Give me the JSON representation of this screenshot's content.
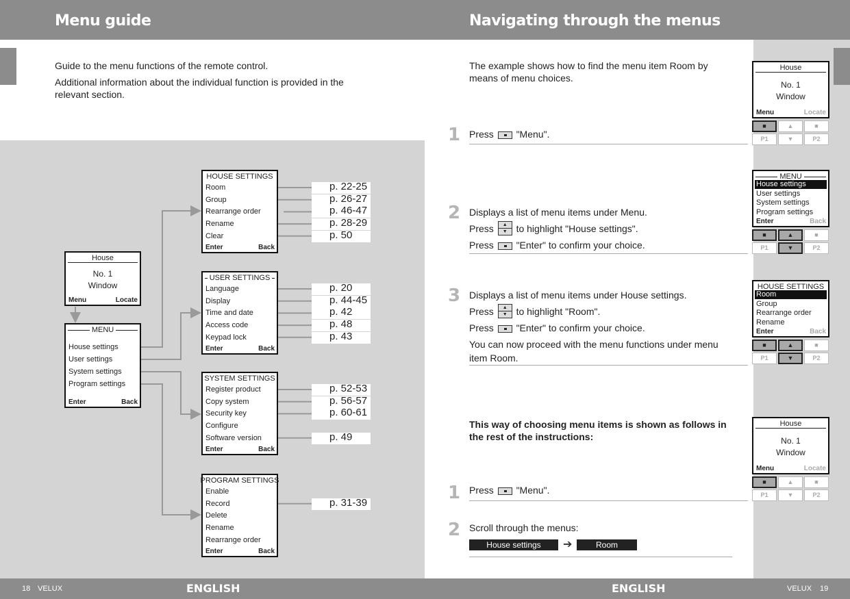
{
  "header": {
    "left_title": "Menu guide",
    "right_title": "Navigating through the menus"
  },
  "left": {
    "intro": [
      "Guide to the menu functions of the remote control.",
      "Additional information about the individual function is provided in the relevant section."
    ]
  },
  "diagram": {
    "home": {
      "title": "House",
      "line1": "No. 1",
      "line2": "Window",
      "left_key": "Menu",
      "right_key": "Locate"
    },
    "menu": {
      "title": "MENU",
      "items": [
        "House settings",
        "User settings",
        "System settings",
        "Program settings"
      ],
      "left_key": "Enter",
      "right_key": "Back"
    },
    "submenus": [
      {
        "title": "HOUSE SETTINGS",
        "items": [
          {
            "label": "Room",
            "page": "p. 22-25"
          },
          {
            "label": "Group",
            "page": "p. 26-27"
          },
          {
            "label": "Rearrange order",
            "page": "p. 46-47"
          },
          {
            "label": "Rename",
            "page": "p. 28-29"
          },
          {
            "label": "Clear",
            "page": "p. 50"
          }
        ],
        "left_key": "Enter",
        "right_key": "Back"
      },
      {
        "title": "USER SETTINGS",
        "items": [
          {
            "label": "Language",
            "page": "p. 20"
          },
          {
            "label": "Display",
            "page": "p. 44-45"
          },
          {
            "label": "Time and date",
            "page": "p. 42"
          },
          {
            "label": "Access code",
            "page": "p. 48"
          },
          {
            "label": "Keypad lock",
            "page": "p. 43"
          }
        ],
        "left_key": "Enter",
        "right_key": "Back"
      },
      {
        "title": "SYSTEM SETTINGS",
        "items": [
          {
            "label": "Register product",
            "page": "p. 52-53"
          },
          {
            "label": "Copy system",
            "page": "p. 56-57"
          },
          {
            "label": "Security key",
            "page": "p. 60-61"
          },
          {
            "label": "Configure",
            "page": ""
          },
          {
            "label": "Software version",
            "page": "p. 49"
          }
        ],
        "left_key": "Enter",
        "right_key": "Back"
      },
      {
        "title": "PROGRAM SETTINGS",
        "items": [
          {
            "label": "Enable",
            "page": ""
          },
          {
            "label": "Record",
            "page": "p. 31-39"
          },
          {
            "label": "Delete",
            "page": ""
          },
          {
            "label": "Rename",
            "page": ""
          },
          {
            "label": "Rearrange order",
            "page": ""
          }
        ],
        "left_key": "Enter",
        "right_key": "Back"
      }
    ]
  },
  "right": {
    "intro": "The example shows how to find the menu item Room by means of menu choices.",
    "steps": [
      {
        "number": "1",
        "lines": [
          {
            "pre": "Press",
            "icon": "menu-key",
            "post": "\"Menu\"."
          }
        ]
      },
      {
        "number": "2",
        "lines": [
          {
            "pre": "Displays a list of menu items under Menu.",
            "icon": "",
            "post": ""
          },
          {
            "pre": "Press",
            "icon": "up-down-key",
            "post": "to highlight \"House settings\"."
          },
          {
            "pre": "Press",
            "icon": "menu-key",
            "post": "\"Enter\" to confirm your choice."
          }
        ]
      },
      {
        "number": "3",
        "lines": [
          {
            "pre": "Displays a list of menu items under House settings.",
            "icon": "",
            "post": ""
          },
          {
            "pre": "Press",
            "icon": "up-down-key",
            "post": "to highlight \"Room\"."
          },
          {
            "pre": "Press",
            "icon": "menu-key",
            "post": "\"Enter\" to confirm your choice."
          }
        ],
        "note": "You can now proceed with the menu functions under menu item Room."
      }
    ],
    "summary_heading": "This way of choosing menu items is shown as follows in the rest of the instructions:",
    "short_steps": [
      {
        "number": "1",
        "pre": "Press",
        "icon": "menu-key",
        "post": "\"Menu\"."
      },
      {
        "number": "2",
        "text": "Scroll through the menus:"
      }
    ],
    "path": [
      "House settings",
      "Room"
    ],
    "devices": [
      {
        "type": "home",
        "title": "House",
        "line1": "No. 1",
        "line2": "Window",
        "left_key": "Menu",
        "right_key": "Locate",
        "active": [
          "left"
        ]
      },
      {
        "type": "list",
        "title": "MENU",
        "items": [
          "House settings",
          "User settings",
          "System settings",
          "Program settings"
        ],
        "highlight": 0,
        "left_key": "Enter",
        "right_key": "Back",
        "active": [
          "left",
          "up",
          "down"
        ]
      },
      {
        "type": "list",
        "title": "HOUSE SETTINGS",
        "items": [
          "Room",
          "Group",
          "Rearrange order",
          "Rename"
        ],
        "highlight": 0,
        "left_key": "Enter",
        "right_key": "Back",
        "active": [
          "left",
          "up",
          "down"
        ]
      },
      {
        "type": "home",
        "title": "House",
        "line1": "No. 1",
        "line2": "Window",
        "left_key": "Menu",
        "right_key": "Locate",
        "active": [
          "left"
        ]
      }
    ],
    "keypad": {
      "p1": "P1",
      "p2": "P2"
    }
  },
  "footer": {
    "left_page": "18",
    "left_brand": "VELUX",
    "left_lang": "ENGLISH",
    "right_lang": "ENGLISH",
    "right_brand": "VELUX",
    "right_page": "19"
  },
  "colors": {
    "bar": "#8c8c8c",
    "panel": "#d4d4d4",
    "highlight": "#111111"
  }
}
